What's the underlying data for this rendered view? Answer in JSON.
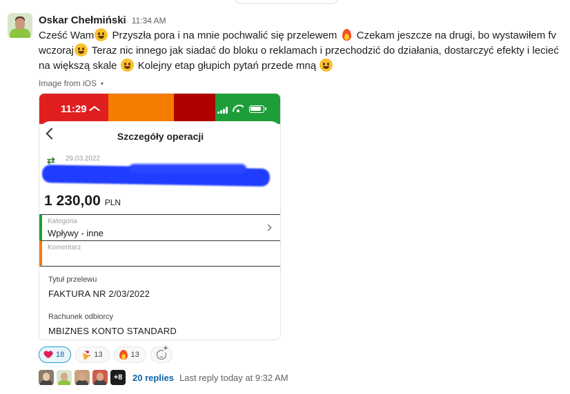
{
  "message": {
    "author": "Oskar Chełmiński",
    "time": "11:34 AM",
    "text_parts": [
      "Cześć Wam",
      " Przyszła pora i na mnie pochwalić się przelewem ",
      " Czekam jeszcze na drugi, bo wystawiłem fv wczoraj",
      " Teraz nic innego jak siadać do bloku o reklamach i przechodzić do działania, dostarczyć efekty i lecieć na większą skale ",
      " Kolejny etap głupich pytań przede mną "
    ],
    "emoji_icons": [
      "shushing-face-icon",
      "fire-icon",
      "slightly-smiling-face-icon",
      "winking-face-icon",
      "grinning-face-icon"
    ]
  },
  "attachment": {
    "label": "Image from iOS",
    "caret": "▾"
  },
  "phone": {
    "status_time": "11:29",
    "status_colors": [
      "#e02020",
      "#f57c00",
      "#b00000",
      "#1e9e3a"
    ],
    "title": "Szczegóły operacji",
    "date": "29.03.2022",
    "amount": "1 230,00",
    "currency": "PLN",
    "category_label": "Kategoria",
    "category_value": "Wpływy - inne",
    "comment_label": "Komentarz",
    "comment_value": "",
    "title_label": "Tytuł przelewu",
    "title_value": "FAKTURA NR 2/03/2022",
    "account_label": "Rachunek odbiorcy",
    "account_value": "MBIZNES KONTO STANDARD",
    "redaction_dot": "."
  },
  "reactions": [
    {
      "icon": "heart-icon",
      "count": "18",
      "active": true
    },
    {
      "icon": "party-popper-icon",
      "count": "13",
      "active": false
    },
    {
      "icon": "fire-icon",
      "count": "13",
      "active": false
    }
  ],
  "thread": {
    "more_count": "+8",
    "replies": "20 replies",
    "last_reply": "Last reply today at 9:32 AM"
  }
}
